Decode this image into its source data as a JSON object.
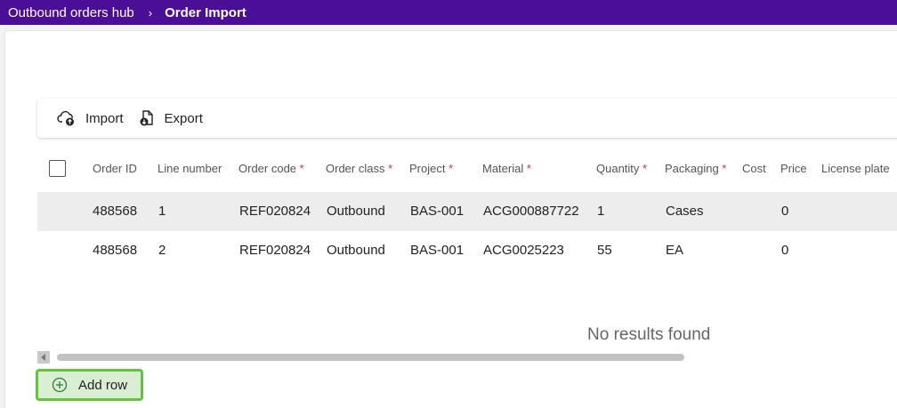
{
  "breadcrumb": {
    "parent": "Outbound orders hub",
    "separator": "›",
    "current": "Order Import"
  },
  "toolbar": {
    "import_label": "Import",
    "export_label": "Export"
  },
  "table": {
    "headers": [
      {
        "label": "Order ID",
        "required": ""
      },
      {
        "label": "Line number",
        "required": ""
      },
      {
        "label": "Order code",
        "required": "*"
      },
      {
        "label": "Order class",
        "required": "*"
      },
      {
        "label": "Project",
        "required": "*"
      },
      {
        "label": "Material",
        "required": "*"
      },
      {
        "label": "Quantity",
        "required": "*"
      },
      {
        "label": "Packaging",
        "required": "*"
      },
      {
        "label": "Cost",
        "required": ""
      },
      {
        "label": "Price",
        "required": ""
      },
      {
        "label": "License plate",
        "required": ""
      }
    ],
    "rows": [
      [
        "488568",
        "1",
        "REF020824",
        "Outbound",
        "BAS-001",
        "ACG000887722",
        "1",
        "Cases",
        "",
        "0",
        ""
      ],
      [
        "488568",
        "2",
        "REF020824",
        "Outbound",
        "BAS-001",
        "ACG0025223",
        "55",
        "EA",
        "",
        "0",
        ""
      ]
    ],
    "empty_message": "No results found"
  },
  "add_row_label": "Add row",
  "colors": {
    "topbar": "#4a0f96",
    "required": "#c4314b",
    "highlight_border": "#64c23c",
    "highlight_fill": "#daeed3"
  }
}
